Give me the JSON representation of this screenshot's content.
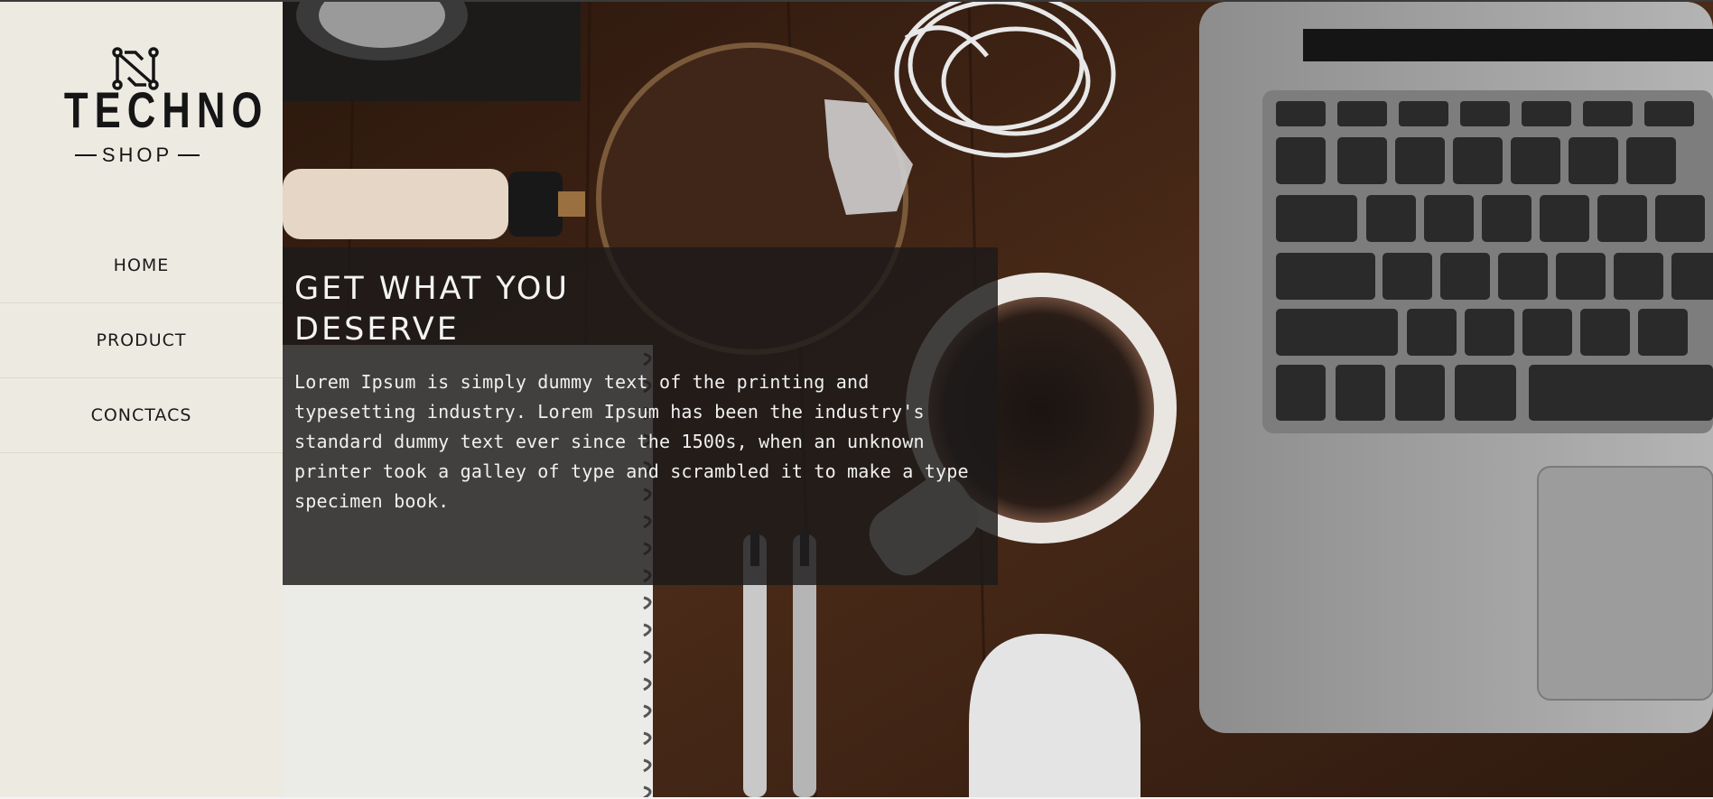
{
  "brand": {
    "name": "TECHNO",
    "tagline": "SHOP",
    "logo_icon": "circuit-n-icon"
  },
  "nav": {
    "items": [
      {
        "label": "HOME"
      },
      {
        "label": "PRODUCT"
      },
      {
        "label": "CONCTACS"
      }
    ]
  },
  "hero": {
    "heading": "GET WHAT YOU DESERVE",
    "body": "Lorem Ipsum is simply dummy text of the printing and typesetting industry. Lorem Ipsum has been the industry's standard dummy text ever since the 1500s, when an unknown printer took a galley of type and scrambled it to make a type specimen book.",
    "image": "desk-with-laptop-coffee-magnifier-photo"
  },
  "colors": {
    "sidebar_bg": "#edeae2",
    "caption_bg": "#1c1a1a",
    "text_dark": "#1a1a1a",
    "text_light": "#f4f4f4"
  }
}
